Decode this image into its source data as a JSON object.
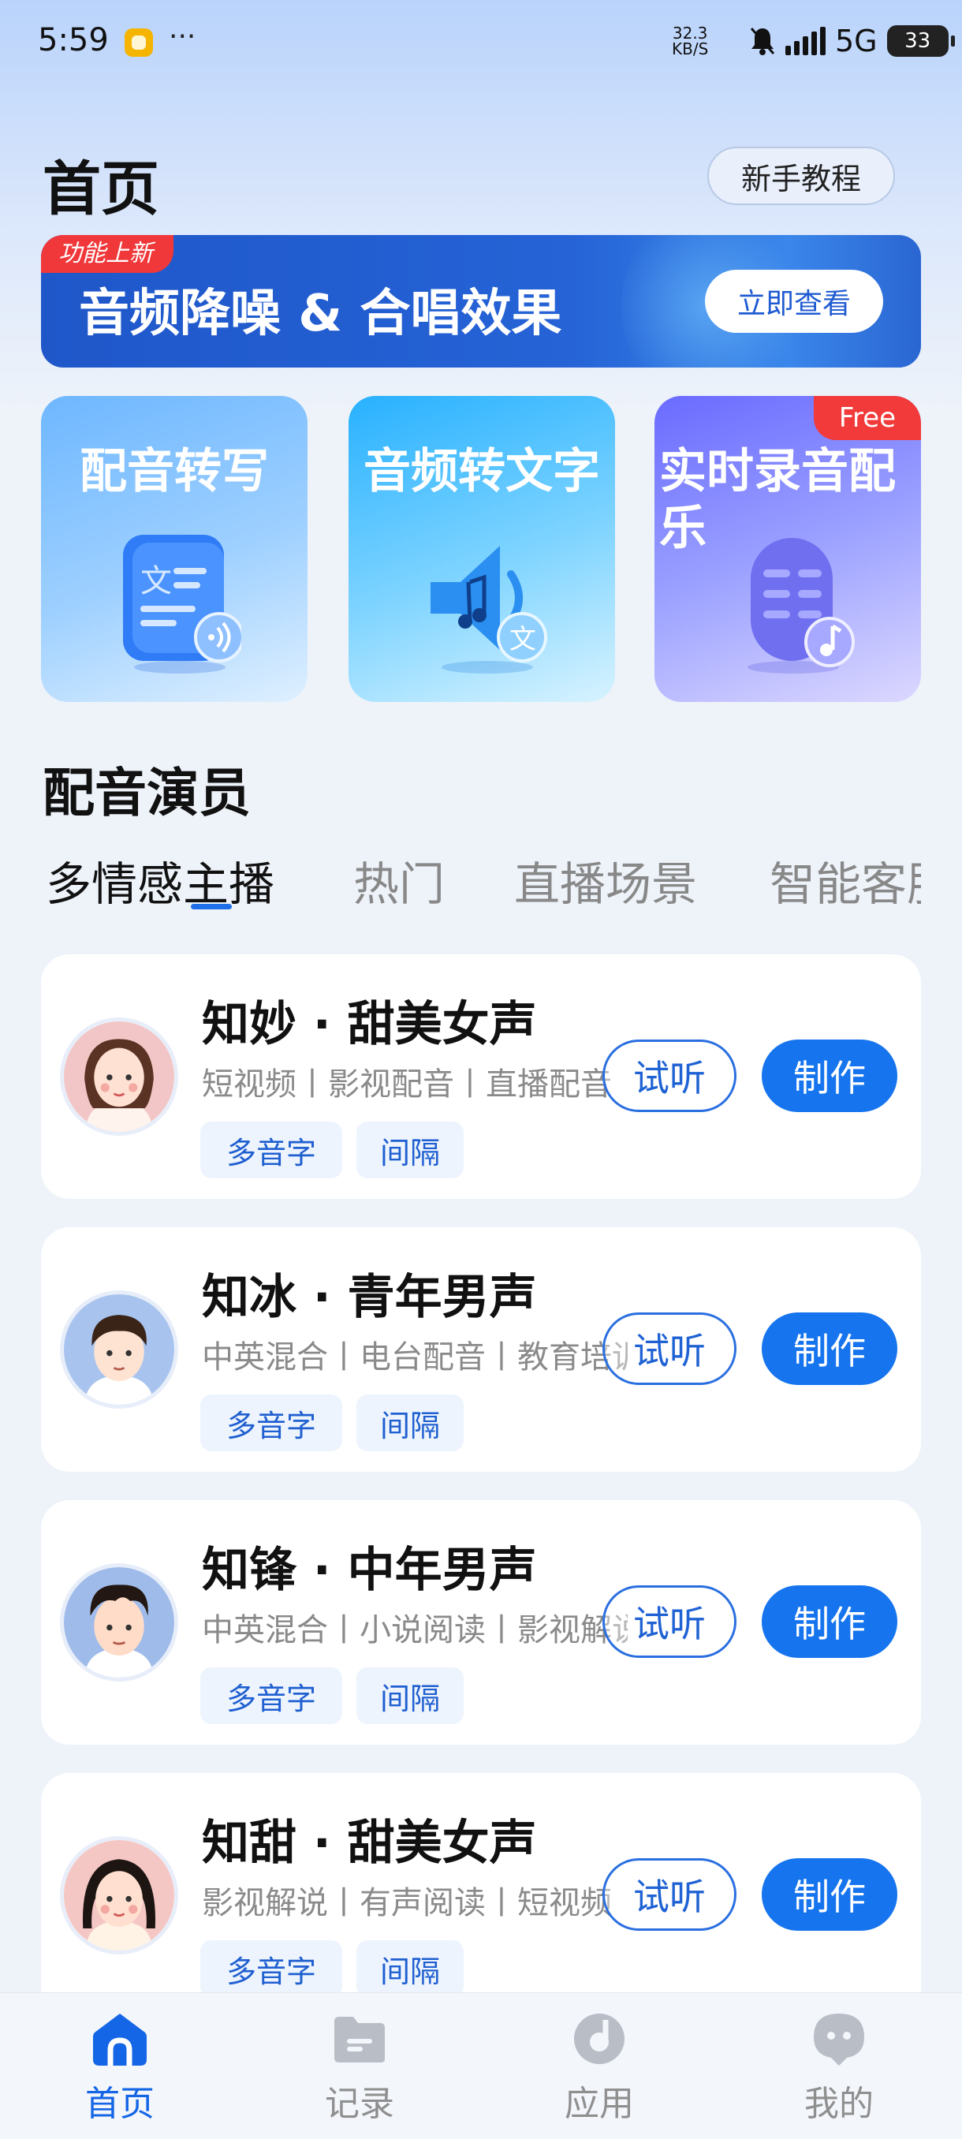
{
  "status_bar": {
    "time": "5:59",
    "ellipsis": "···",
    "net_speed_value": "32.3",
    "net_speed_unit": "KB/S",
    "network": "5G",
    "battery": "33"
  },
  "header": {
    "title": "首页",
    "tutorial_label": "新手教程"
  },
  "banner": {
    "tag": "功能上新",
    "title": "音频降噪 & 合唱效果",
    "button_label": "立即查看"
  },
  "features": [
    {
      "title": "配音转写",
      "icon": "document-audio-icon"
    },
    {
      "title": "音频转文字",
      "icon": "speaker-text-icon"
    },
    {
      "title": "实时录音配乐",
      "icon": "microphone-music-icon",
      "badge": "Free"
    }
  ],
  "section": {
    "title": "配音演员",
    "tabs": [
      "多情感主播",
      "热门",
      "直播场景",
      "智能客服"
    ],
    "active_tab": 0
  },
  "voices": [
    {
      "name": "知妙 · 甜美女声",
      "desc": "短视频丨影视配音丨直播配音",
      "tags": [
        "多音字",
        "间隔"
      ],
      "listen": "试听",
      "make": "制作"
    },
    {
      "name": "知冰 · 青年男声",
      "desc": "中英混合丨电台配音丨教育培训",
      "tags": [
        "多音字",
        "间隔"
      ],
      "listen": "试听",
      "make": "制作"
    },
    {
      "name": "知锋 · 中年男声",
      "desc": "中英混合丨小说阅读丨影视解说",
      "tags": [
        "多音字",
        "间隔"
      ],
      "listen": "试听",
      "make": "制作"
    },
    {
      "name": "知甜 · 甜美女声",
      "desc": "影视解说丨有声阅读丨短视频",
      "tags": [
        "多音字",
        "间隔"
      ],
      "listen": "试听",
      "make": "制作"
    }
  ],
  "bottom_nav": [
    {
      "label": "首页",
      "icon": "home-icon",
      "active": true
    },
    {
      "label": "记录",
      "icon": "folder-icon",
      "active": false
    },
    {
      "label": "应用",
      "icon": "apps-icon",
      "active": false
    },
    {
      "label": "我的",
      "icon": "profile-icon",
      "active": false
    }
  ],
  "colors": {
    "accent": "#1574EE",
    "banner": "#2563D6",
    "tag_red": "#F0383B",
    "tag_bg": "#EDF4FE"
  }
}
